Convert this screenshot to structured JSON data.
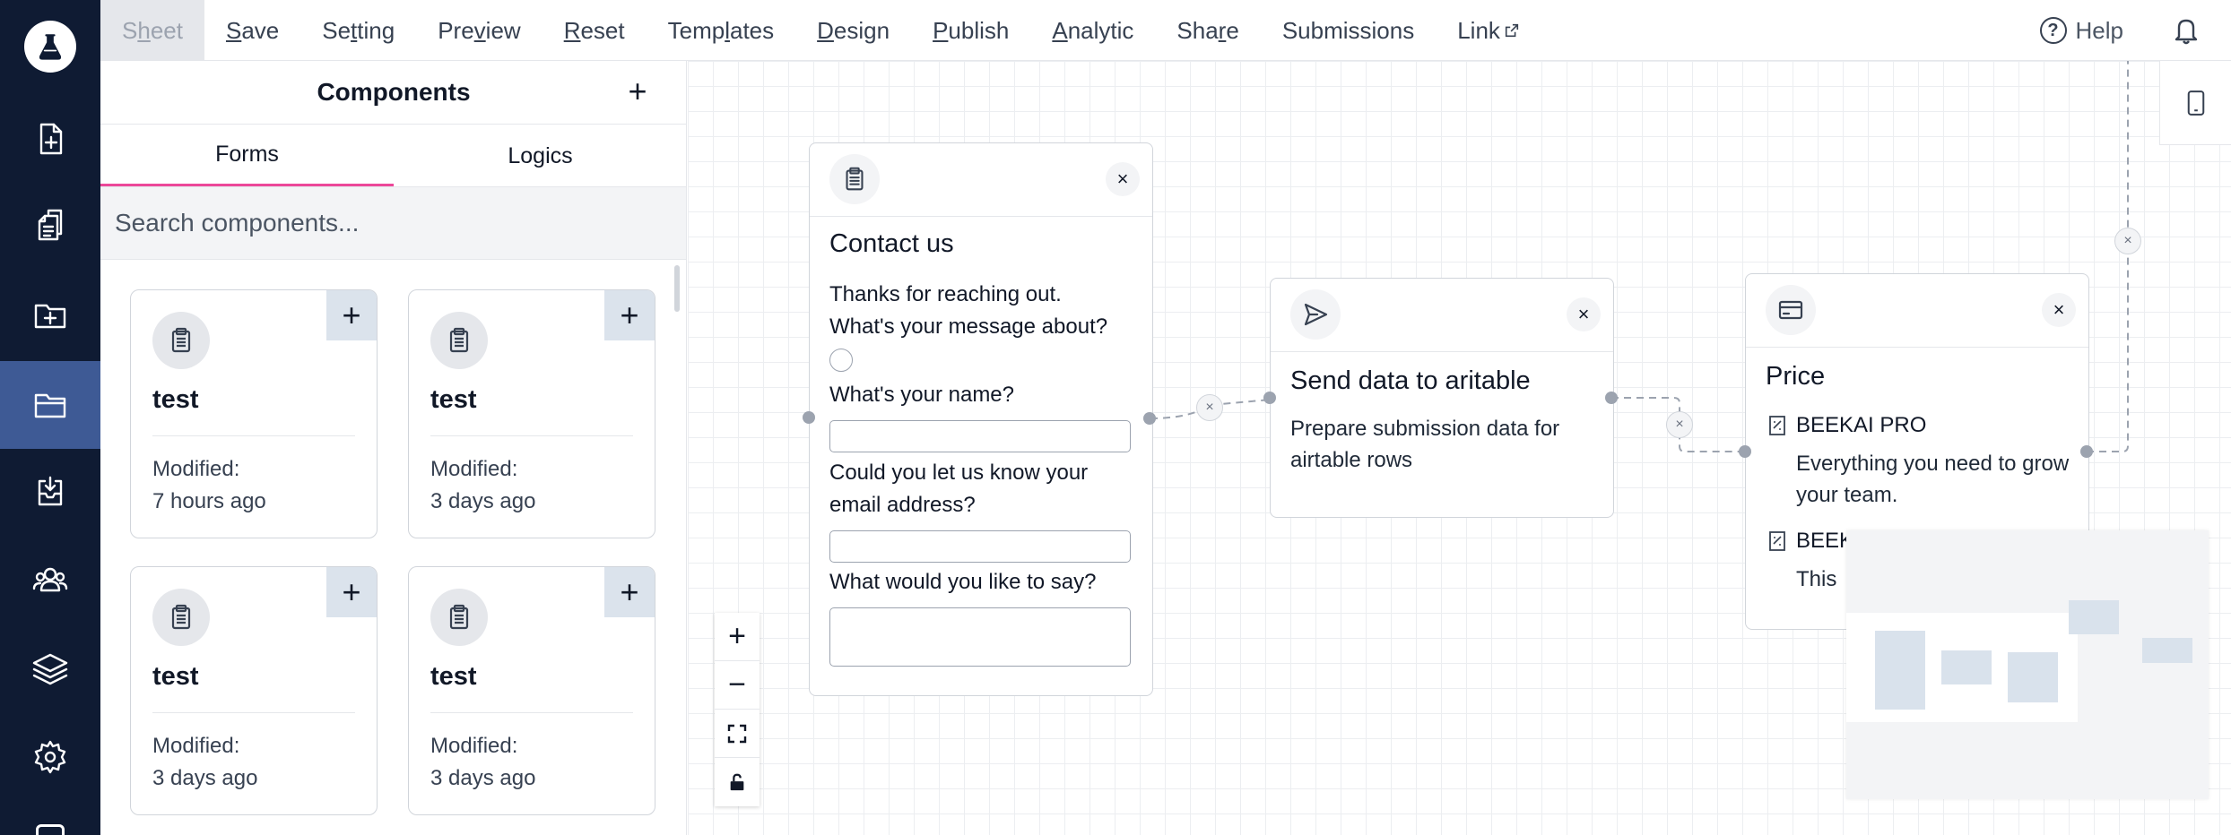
{
  "rail": {
    "items": [
      {
        "icon": "file-plus-icon",
        "active": false
      },
      {
        "icon": "copy-icon",
        "active": false
      },
      {
        "icon": "folder-plus-icon",
        "active": false
      },
      {
        "icon": "folder-icon",
        "active": true
      },
      {
        "icon": "inbox-icon",
        "active": false
      },
      {
        "icon": "users-icon",
        "active": false
      },
      {
        "icon": "layers-icon",
        "active": false
      },
      {
        "icon": "gear-icon",
        "active": false
      }
    ]
  },
  "menu": {
    "sheet_pre": "S",
    "sheet_u": "h",
    "sheet_post": "eet",
    "save_u": "S",
    "save_post": "ave",
    "setting_pre": "Se",
    "setting_u": "t",
    "setting_post": "ting",
    "preview_pre": "Pre",
    "preview_u": "v",
    "preview_post": "iew",
    "reset_u": "R",
    "reset_post": "eset",
    "templates_pre": "Temp",
    "templates_u": "l",
    "templates_post": "ates",
    "design_u": "D",
    "design_post": "esign",
    "publish_u": "P",
    "publish_post": "ublish",
    "analytic_u": "A",
    "analytic_post": "nalytic",
    "share_pre": "Sha",
    "share_u": "r",
    "share_post": "e",
    "submissions": "Submissions",
    "link": "Link",
    "help": "Help"
  },
  "panel": {
    "title": "Components",
    "tabs": [
      "Forms",
      "Logics"
    ],
    "search_placeholder": "Search components...",
    "cards": [
      {
        "name": "test",
        "modified_label": "Modified:",
        "modified_value": "7 hours ago"
      },
      {
        "name": "test",
        "modified_label": "Modified:",
        "modified_value": "3 days ago"
      },
      {
        "name": "test",
        "modified_label": "Modified:",
        "modified_value": "3 days ago"
      },
      {
        "name": "test",
        "modified_label": "Modified:",
        "modified_value": "3 days ago"
      }
    ]
  },
  "canvas": {
    "contact_node": {
      "title": "Contact us",
      "intro": "Thanks for reaching out.",
      "q_about": "What's your message about?",
      "q_name": "What's your name?",
      "q_email": "Could you let us know your email address?",
      "q_say": "What would you like to say?"
    },
    "airtable_node": {
      "title": "Send data to aritable",
      "description": "Prepare submission data for airtable rows"
    },
    "price_node": {
      "title": "Price",
      "item1_name": "BEEKAI PRO",
      "item1_desc": "Everything you need to grow your team.",
      "item2_name": "BEEK",
      "item2_desc": "This"
    },
    "zoom": {
      "plus": "+",
      "minus": "−"
    }
  }
}
